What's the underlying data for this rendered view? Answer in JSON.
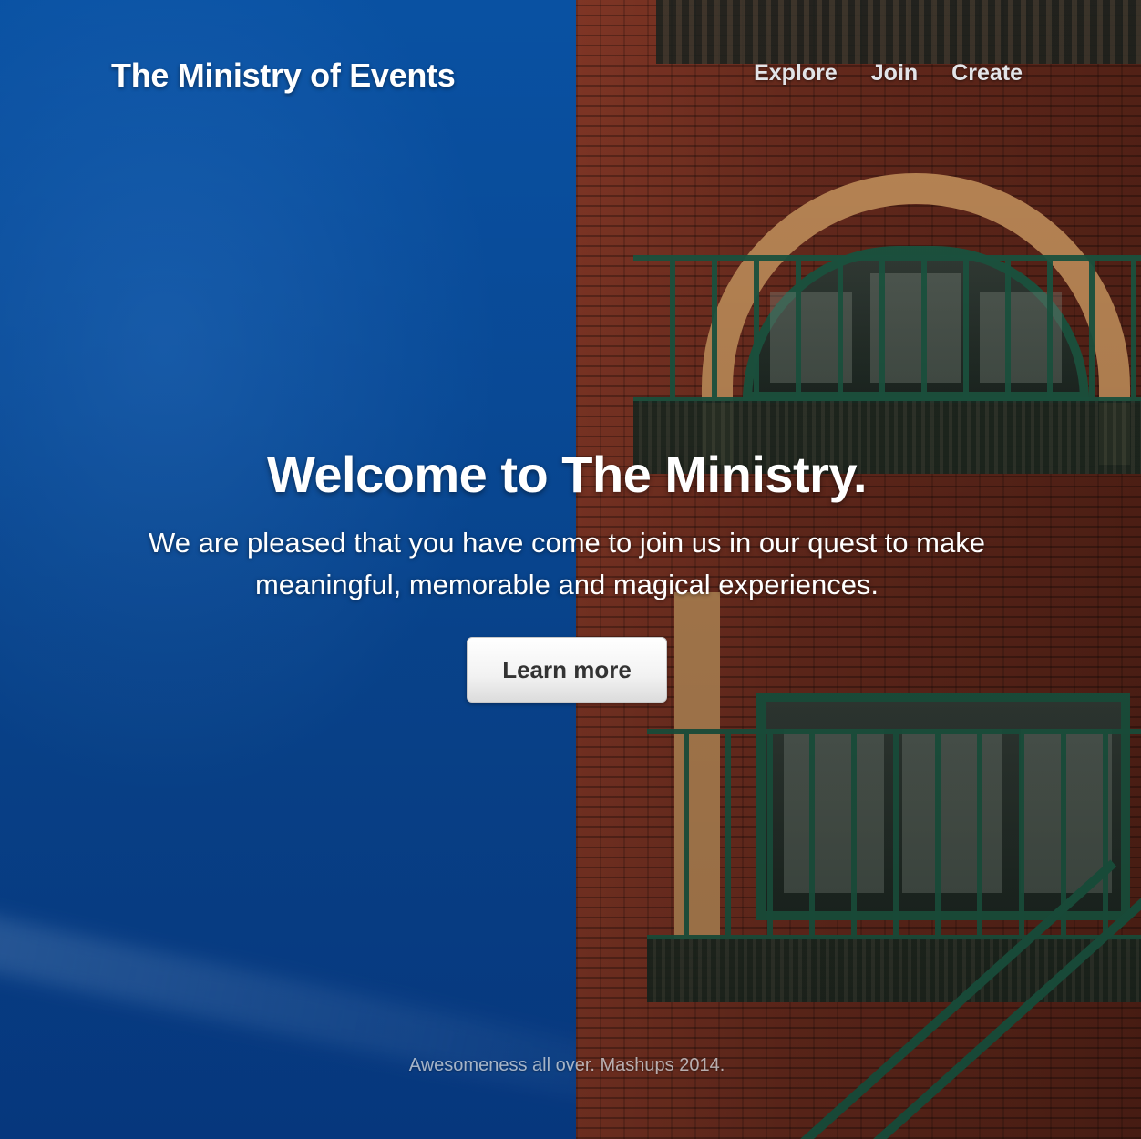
{
  "site": {
    "brand": "The Ministry of Events"
  },
  "nav": {
    "items": [
      {
        "label": "Explore"
      },
      {
        "label": "Join"
      },
      {
        "label": "Create"
      }
    ]
  },
  "hero": {
    "title": "Welcome to The Ministry.",
    "subtitle": "We are pleased that you have come to join us in our quest to make meaningful, memorable and magical experiences.",
    "cta_label": "Learn more"
  },
  "footer": {
    "text": "Awesomeness all over. Mashups 2014."
  },
  "colors": {
    "sky_blue": "#0a55ae",
    "brick_red": "#7a3324",
    "fire_escape_green": "#1e5c46",
    "button_text": "#333333"
  }
}
